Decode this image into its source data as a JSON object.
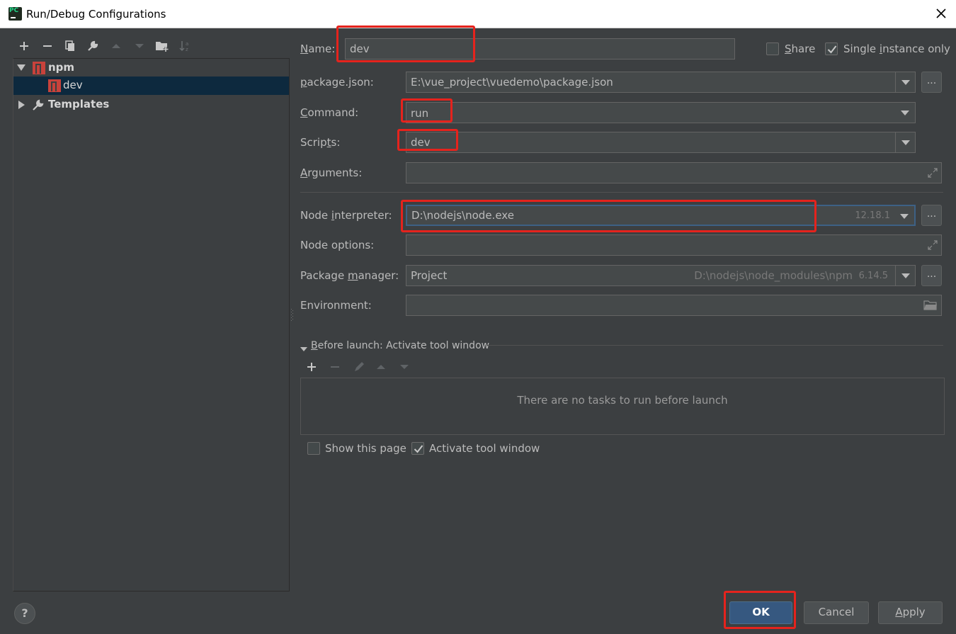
{
  "window": {
    "title": "Run/Debug Configurations",
    "app_icon_text": "PC"
  },
  "tree": {
    "groups": [
      {
        "label": "npm",
        "expanded": true,
        "children": [
          {
            "label": "dev",
            "selected": true
          }
        ]
      },
      {
        "label": "Templates",
        "expanded": false
      }
    ]
  },
  "form": {
    "name_label_pre": "",
    "name_label_u": "N",
    "name_label_post": "ame:",
    "name_value": "dev",
    "share_label_u": "S",
    "share_label_post": "hare",
    "share_checked": false,
    "single_label_pre": "Single ",
    "single_label_u": "i",
    "single_label_post": "nstance only",
    "single_checked": true,
    "package_json_label_u": "p",
    "package_json_label_post": "ackage.json:",
    "package_json_value": "E:\\vue_project\\vuedemo\\package.json",
    "command_label_pre": "",
    "command_label_u": "C",
    "command_label_post": "ommand:",
    "command_value": "run",
    "scripts_label_pre": "Scrip",
    "scripts_label_u": "t",
    "scripts_label_post": "s:",
    "scripts_value": "dev",
    "arguments_label_pre": "",
    "arguments_label_u": "A",
    "arguments_label_post": "rguments:",
    "arguments_value": "",
    "node_interpreter_label_pre": "Node ",
    "node_interpreter_label_u": "i",
    "node_interpreter_label_post": "nterpreter:",
    "node_interpreter_value": "D:\\nodejs\\node.exe",
    "node_version": "12.18.1",
    "node_options_label": "Node options:",
    "node_options_value": "",
    "package_manager_label_pre": "Package ",
    "package_manager_label_u": "m",
    "package_manager_label_post": "anager:",
    "package_manager_value": "Project",
    "package_manager_path": "D:\\nodejs\\node_modules\\npm",
    "package_manager_version": "6.14.5",
    "environment_label": "Environment:",
    "environment_value": ""
  },
  "before_launch": {
    "title_u": "B",
    "title_post": "efore launch: Activate tool window",
    "empty_message": "There are no tasks to run before launch",
    "show_page_label": "Show this page",
    "show_page_checked": false,
    "activate_label": "Activate tool window",
    "activate_checked": true
  },
  "buttons": {
    "ok": "OK",
    "cancel": "Cancel",
    "apply_u": "A",
    "apply_post": "pply",
    "help": "?"
  },
  "colors": {
    "background": "#3c3f41",
    "field": "#45494a",
    "selection": "#0d293e",
    "default_button": "#365880",
    "highlight": "#e5231d",
    "npm_red": "#c8423b"
  }
}
